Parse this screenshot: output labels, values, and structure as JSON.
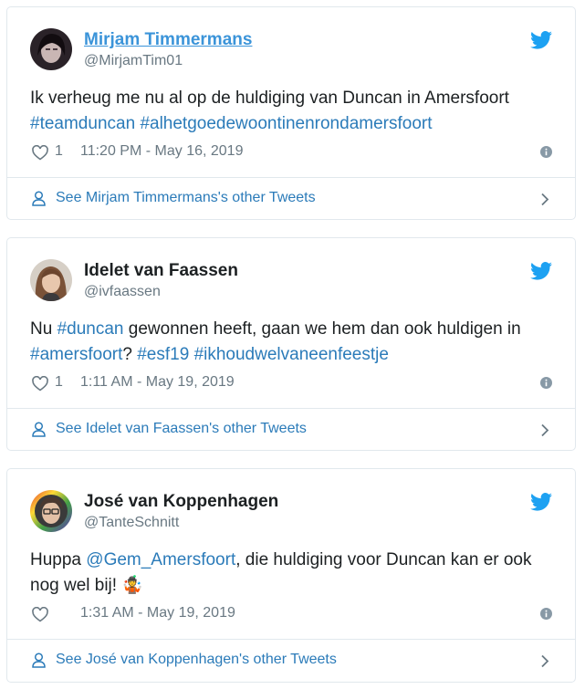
{
  "tweets": [
    {
      "name": "Mirjam Timmermans",
      "handle": "@MirjamTim01",
      "text_plain": "Ik verheug me nu al op de huldiging van Duncan in Amersfoort",
      "hashtag_1": "#teamduncan",
      "hashtag_2": "#alhetgoedewoontinenrondamersfoort",
      "likes": "1",
      "timestamp": "11:20 PM - May 16, 2019",
      "footer": "See Mirjam Timmermans's other Tweets"
    },
    {
      "name": "Idelet van Faassen",
      "handle": "@ivfaassen",
      "text_1": "Nu",
      "hashtag_duncan": "#duncan",
      "text_2": "gewonnen heeft, gaan we hem dan ook huldigen in",
      "hashtag_amersfoort": "#amersfoort",
      "text_3": "?",
      "hashtag_esf19": "#esf19",
      "hashtag_feestje": "#ikhoudwelvaneenfeestje",
      "likes": "1",
      "timestamp": "1:11 AM - May 19, 2019",
      "footer": "See Idelet van Faassen's other Tweets"
    },
    {
      "name": "José van Koppenhagen",
      "handle": "@TanteSchnitt",
      "text_1": "Huppa",
      "mention": "@Gem_Amersfoort",
      "text_2": ", die huldiging voor Duncan kan er ook nog wel bij!",
      "emoji": "🤹",
      "likes": "",
      "timestamp": "1:31 AM - May 19, 2019",
      "footer": "See José van Koppenhagen's other Tweets"
    }
  ],
  "icons": {
    "brand": "twitter-bird-icon",
    "like": "heart-icon",
    "info": "info-icon",
    "profile": "person-icon",
    "navigate": "chevron-right-icon"
  },
  "colors": {
    "link": "#2b7bb9",
    "name_link": "#3b94d9",
    "twitter_blue": "#1da1f2",
    "muted": "#697882",
    "border": "#e1e8ed"
  }
}
